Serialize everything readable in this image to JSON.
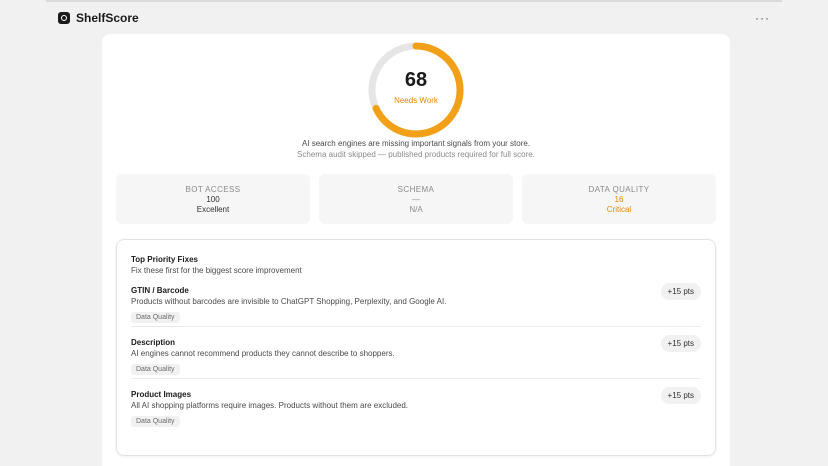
{
  "app": {
    "name": "ShelfScore",
    "more_label": "···"
  },
  "score": {
    "value": "68",
    "max": 100,
    "label": "Needs Work",
    "accent_color": "#f2a017",
    "track_color": "#e6e6e6",
    "description": "AI search engines are missing important signals from your store.",
    "note": "Schema audit skipped — published products required for full score."
  },
  "metrics": [
    {
      "label": "BOT ACCESS",
      "value": "100",
      "status": "Excellent"
    },
    {
      "label": "SCHEMA",
      "value": "—",
      "status": "N/A"
    },
    {
      "label": "DATA QUALITY",
      "value": "16",
      "status": "Critical"
    }
  ],
  "fixes": {
    "title": "Top Priority Fixes",
    "subtitle": "Fix these first for the biggest score improvement",
    "items": [
      {
        "title": "GTIN / Barcode",
        "description": "Products without barcodes are invisible to ChatGPT Shopping, Perplexity, and Google AI.",
        "tag": "Data Quality",
        "points": "+15 pts"
      },
      {
        "title": "Description",
        "description": "AI engines cannot recommend products they cannot describe to shoppers.",
        "tag": "Data Quality",
        "points": "+15 pts"
      },
      {
        "title": "Product Images",
        "description": "All AI shopping platforms require images. Products without them are excluded.",
        "tag": "Data Quality",
        "points": "+15 pts"
      }
    ]
  }
}
